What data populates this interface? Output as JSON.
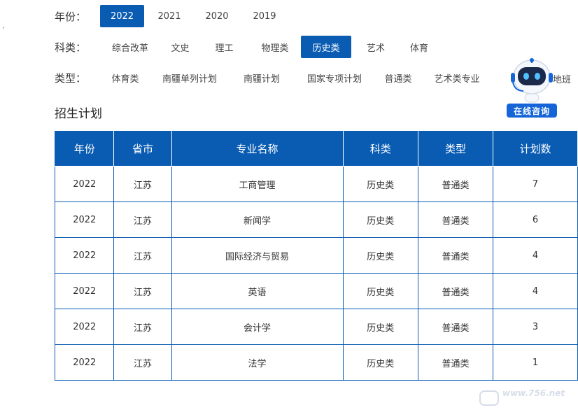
{
  "filters": {
    "year": {
      "label": "年份：",
      "options": [
        "2022",
        "2021",
        "2020",
        "2019"
      ],
      "selected": "2022"
    },
    "subject": {
      "label": "科类：",
      "options": [
        "综合改革",
        "文史",
        "理工",
        "物理类",
        "历史类",
        "艺术",
        "体育"
      ],
      "selected": "历史类"
    },
    "type": {
      "label": "类型：",
      "options": [
        "体育类",
        "南疆单列计划",
        "南疆计划",
        "国家专项计划",
        "普通类",
        "艺术类专业"
      ],
      "overflow_text": "地班"
    }
  },
  "assistant": {
    "label": "在线咨询"
  },
  "section": {
    "title": "招生计划"
  },
  "table": {
    "headers": [
      "年份",
      "省市",
      "专业名称",
      "科类",
      "类型",
      "计划数"
    ],
    "rows": [
      [
        "2022",
        "江苏",
        "工商管理",
        "历史类",
        "普通类",
        "7"
      ],
      [
        "2022",
        "江苏",
        "新闻学",
        "历史类",
        "普通类",
        "6"
      ],
      [
        "2022",
        "江苏",
        "国际经济与贸易",
        "历史类",
        "普通类",
        "4"
      ],
      [
        "2022",
        "江苏",
        "英语",
        "历史类",
        "普通类",
        "4"
      ],
      [
        "2022",
        "江苏",
        "会计学",
        "历史类",
        "普通类",
        "3"
      ],
      [
        "2022",
        "江苏",
        "法学",
        "历史类",
        "普通类",
        "1"
      ]
    ]
  },
  "watermark": {
    "text": "www.756.net"
  },
  "colors": {
    "accent": "#0a5cb3",
    "border": "#0a5cb3"
  }
}
